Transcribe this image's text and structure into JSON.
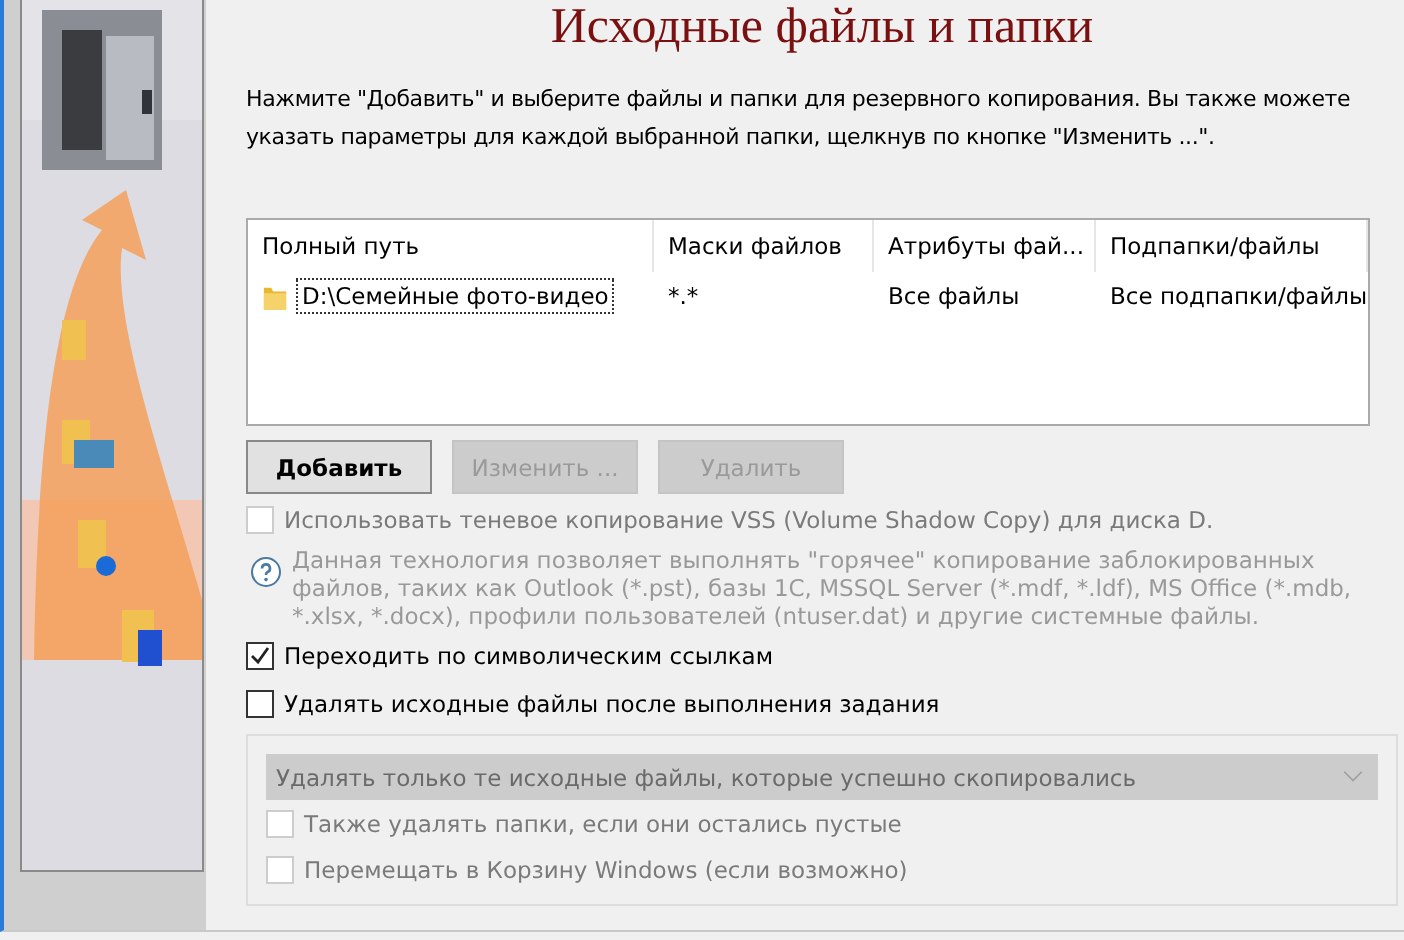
{
  "title": "Исходные файлы и папки",
  "description": "Нажмите \"Добавить\" и выберите файлы и папки для резервного копирования. Вы также можете указать параметры для каждой выбранной папки, щелкнув по кнопке \"Изменить ...\".",
  "table": {
    "columns": [
      "Полный путь",
      "Маски файлов",
      "Атрибуты фай...",
      "Подпапки/файлы"
    ],
    "rows": [
      {
        "cells": [
          "D:\\Семейные фото-видео",
          "*.*",
          "Все файлы",
          "Все подпапки/файлы"
        ],
        "selected": true
      }
    ]
  },
  "buttons": [
    {
      "label": "Добавить",
      "disabled": false,
      "default": true
    },
    {
      "label": "Изменить ...",
      "disabled": true,
      "default": false
    },
    {
      "label": "Удалить",
      "disabled": true,
      "default": false
    }
  ],
  "vss": {
    "label": "Использовать теневое копирование VSS (Volume Shadow Copy) для диска D.",
    "checked": false,
    "disabled": true
  },
  "vss_help": "Данная технология позволяет выполнять \"горячее\" копирование заблокированных файлов, таких как Outlook (*.pst), базы 1С, MSSQL Server (*.mdf, *.ldf), MS Office (*.mdb, *.xlsx, *.docx), профили пользователей (ntuser.dat) и другие системные файлы.",
  "options": [
    {
      "label": "Переходить по символическим ссылкам",
      "checked": true,
      "disabled": false
    },
    {
      "label": "Удалять исходные файлы после выполнения задания",
      "checked": false,
      "disabled": false
    }
  ],
  "delete_group": {
    "dropdown": {
      "value": "Удалять только те исходные файлы, которые успешно скопировались",
      "disabled": true
    },
    "options": [
      {
        "label": "Также удалять папки, если они остались пустые",
        "checked": false,
        "disabled": true
      },
      {
        "label": "Перемещать в Корзину Windows (если возможно)",
        "checked": false,
        "disabled": true
      }
    ]
  }
}
